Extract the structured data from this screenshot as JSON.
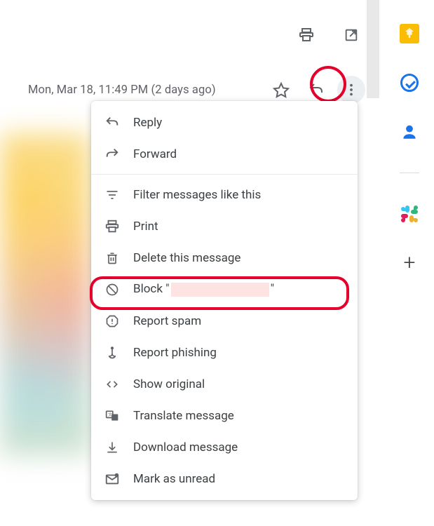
{
  "toolbar": {
    "print": "Print",
    "openInNew": "Open in new window"
  },
  "meta": {
    "timestamp": "Mon, Mar 18, 11:49 PM (2 days ago)",
    "star": "Not starred",
    "reply": "Reply",
    "more": "More"
  },
  "menu": {
    "reply": "Reply",
    "forward": "Forward",
    "filter": "Filter messages like this",
    "print": "Print",
    "delete": "Delete this message",
    "block_prefix": "Block \"",
    "block_suffix": "\"",
    "reportSpam": "Report spam",
    "reportPhishing": "Report phishing",
    "showOriginal": "Show original",
    "translate": "Translate message",
    "download": "Download message",
    "markUnread": "Mark as unread"
  },
  "sidepanel": {
    "keep": "Keep",
    "tasks": "Tasks",
    "contacts": "Contacts",
    "slack": "Slack",
    "add": "Get Add-ons"
  }
}
